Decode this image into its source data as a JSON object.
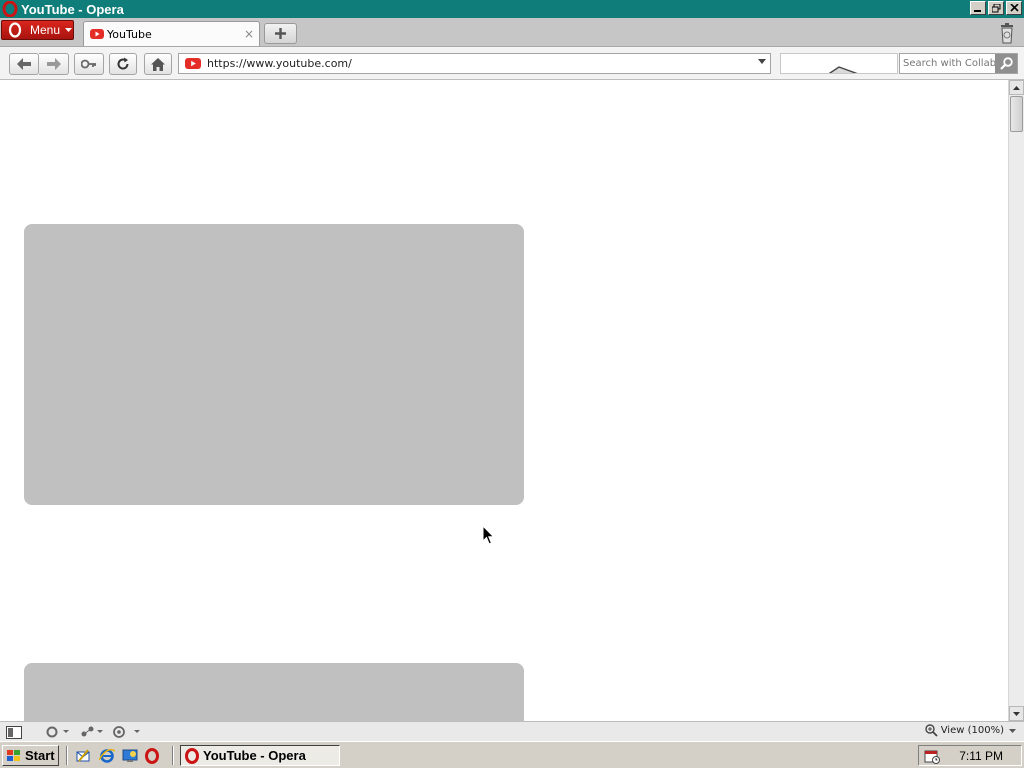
{
  "window": {
    "title": "YouTube - Opera",
    "controls": [
      "minimize",
      "restore",
      "close"
    ]
  },
  "tabstrip": {
    "menu_label": "Menu",
    "tabs": [
      {
        "title": "YouTube",
        "icon": "youtube-favicon-icon",
        "close": "×"
      }
    ],
    "new_tab_icon": "plus-icon",
    "trash_icon": "trash-icon"
  },
  "toolbar": {
    "buttons": [
      "back-icon",
      "forward-icon",
      "key-icon",
      "reload-icon",
      "home-icon"
    ],
    "address": {
      "url": "https://www.youtube.com/",
      "icon": "youtube-favicon-icon"
    },
    "search": {
      "placeholder": "Search with Collab"
    }
  },
  "statusbar": {
    "zoom_label": "View (100%)"
  },
  "taskbar": {
    "start_label": "Start",
    "task_title": "YouTube - Opera",
    "clock": "7:11 PM"
  },
  "colors": {
    "titlebar": "#0f7e7a",
    "opera_red": "#c8181a",
    "placeholder": "#c0c0c0"
  }
}
